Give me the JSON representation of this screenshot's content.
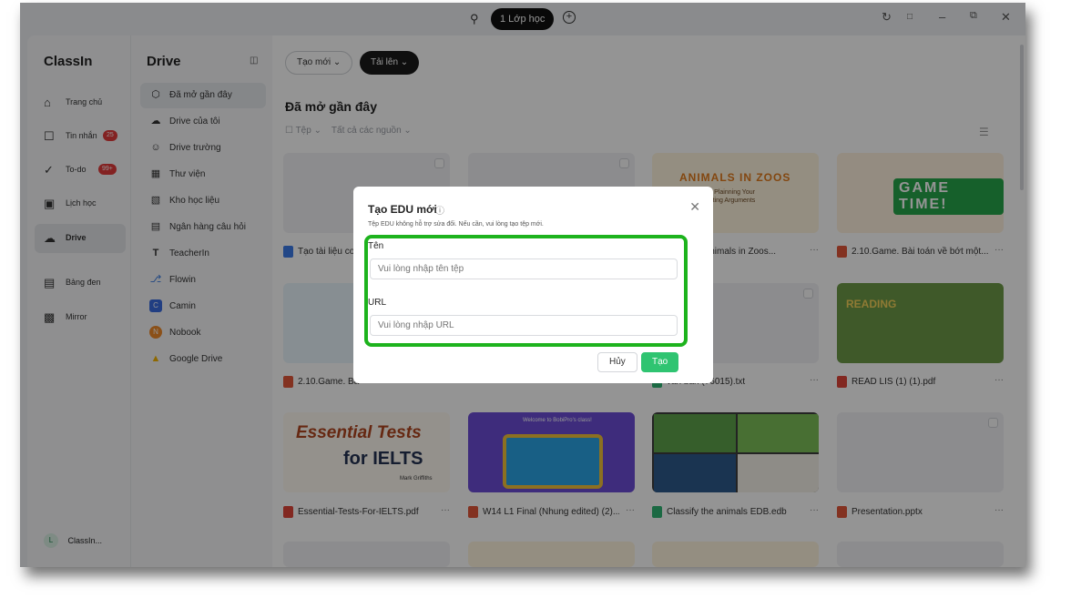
{
  "titlebar": {
    "search_icon": "search-icon",
    "class_button": "1 Lớp học",
    "controls": [
      "refresh-icon",
      "layout-icon",
      "minimize-icon",
      "restore-icon",
      "close-icon"
    ]
  },
  "leftnav": {
    "brand": "ClassIn",
    "items": [
      {
        "label": "Trang chủ",
        "icon": "home-icon"
      },
      {
        "label": "Tin nhắn",
        "icon": "chat-icon",
        "badge": "25"
      },
      {
        "label": "To-do",
        "icon": "check-icon",
        "badge": "99+"
      },
      {
        "label": "Lịch học",
        "icon": "calendar-icon"
      },
      {
        "label": "Drive",
        "icon": "drive-icon",
        "active": true
      },
      {
        "label": "Bảng đen",
        "icon": "board-icon"
      },
      {
        "label": "Mirror",
        "icon": "mirror-icon"
      }
    ],
    "user": {
      "initial": "L",
      "name": "ClassIn..."
    }
  },
  "drive": {
    "title": "Drive",
    "items": [
      {
        "label": "Đã mở gần đây",
        "active": true
      },
      {
        "label": "Drive của tôi"
      },
      {
        "label": "Drive trường"
      },
      {
        "label": "Thư viện"
      },
      {
        "label": "Kho học liệu"
      },
      {
        "label": "Ngân hàng câu hỏi"
      },
      {
        "label": "TeacherIn"
      },
      {
        "label": "Flowin"
      },
      {
        "label": "Camin"
      },
      {
        "label": "Nobook"
      },
      {
        "label": "Google Drive"
      }
    ]
  },
  "main": {
    "new_button": "Tạo mới",
    "upload_button": "Tải lên",
    "section_title": "Đã mở gần đây",
    "filter_type": "Tệp",
    "filter_source": "Tất cả các nguồn",
    "files": [
      {
        "name": "Tạo tài liệu cơ",
        "type": "doc",
        "color": "#3b7be8"
      },
      {
        "name": "",
        "type": "blank",
        "color": "#e8e8e8"
      },
      {
        "name": "- Day 3 - Animals in Zoos...",
        "type": "edb",
        "color": "#2fb574"
      },
      {
        "name": "2.10.Game. Bài toán về bớt một...",
        "type": "ppt",
        "color": "#e2573a"
      },
      {
        "name": "2.10.Game. Bà",
        "type": "ppt",
        "color": "#e2573a"
      },
      {
        "name": "",
        "type": "ppt",
        "color": "#e2573a"
      },
      {
        "name": "văn bản (76015).txt",
        "type": "txt",
        "color": "#2fb574"
      },
      {
        "name": "READ LIS (1) (1).pdf",
        "type": "pdf",
        "color": "#e0453a"
      },
      {
        "name": "Essential-Tests-For-IELTS.pdf",
        "type": "pdf",
        "color": "#e0453a"
      },
      {
        "name": "W14 L1 Final (Nhung edited) (2)...",
        "type": "ppt",
        "color": "#e2573a"
      },
      {
        "name": "Classify the animals EDB.edb",
        "type": "edb",
        "color": "#2fb574"
      },
      {
        "name": "Presentation.pptx",
        "type": "ppt",
        "color": "#e2573a"
      }
    ],
    "thumb_text": {
      "animals_title": "ANIMALS IN ZOOS",
      "animals_sub1": "Day 3: Plainning Your",
      "animals_sub2": "Supporting Arguments",
      "game": "GAME TIME!",
      "reading": "READING",
      "ess1": "Essential Tests",
      "ess2": "for IELTS",
      "ess3": "Mark Griffiths",
      "w14": "Welcome to BobiPro's class!"
    }
  },
  "dialog": {
    "title": "Tạo EDU mới",
    "subtitle": "Tệp EDU không hỗ trợ sửa đổi. Nếu cần, vui lòng tạo tệp mới.",
    "name_label": "Tên",
    "name_placeholder": "Vui lòng nhập tên tệp",
    "url_label": "URL",
    "url_placeholder": "Vui lòng nhập URL",
    "cancel": "Hủy",
    "confirm": "Tạo",
    "highlight_color": "#1db31d"
  }
}
